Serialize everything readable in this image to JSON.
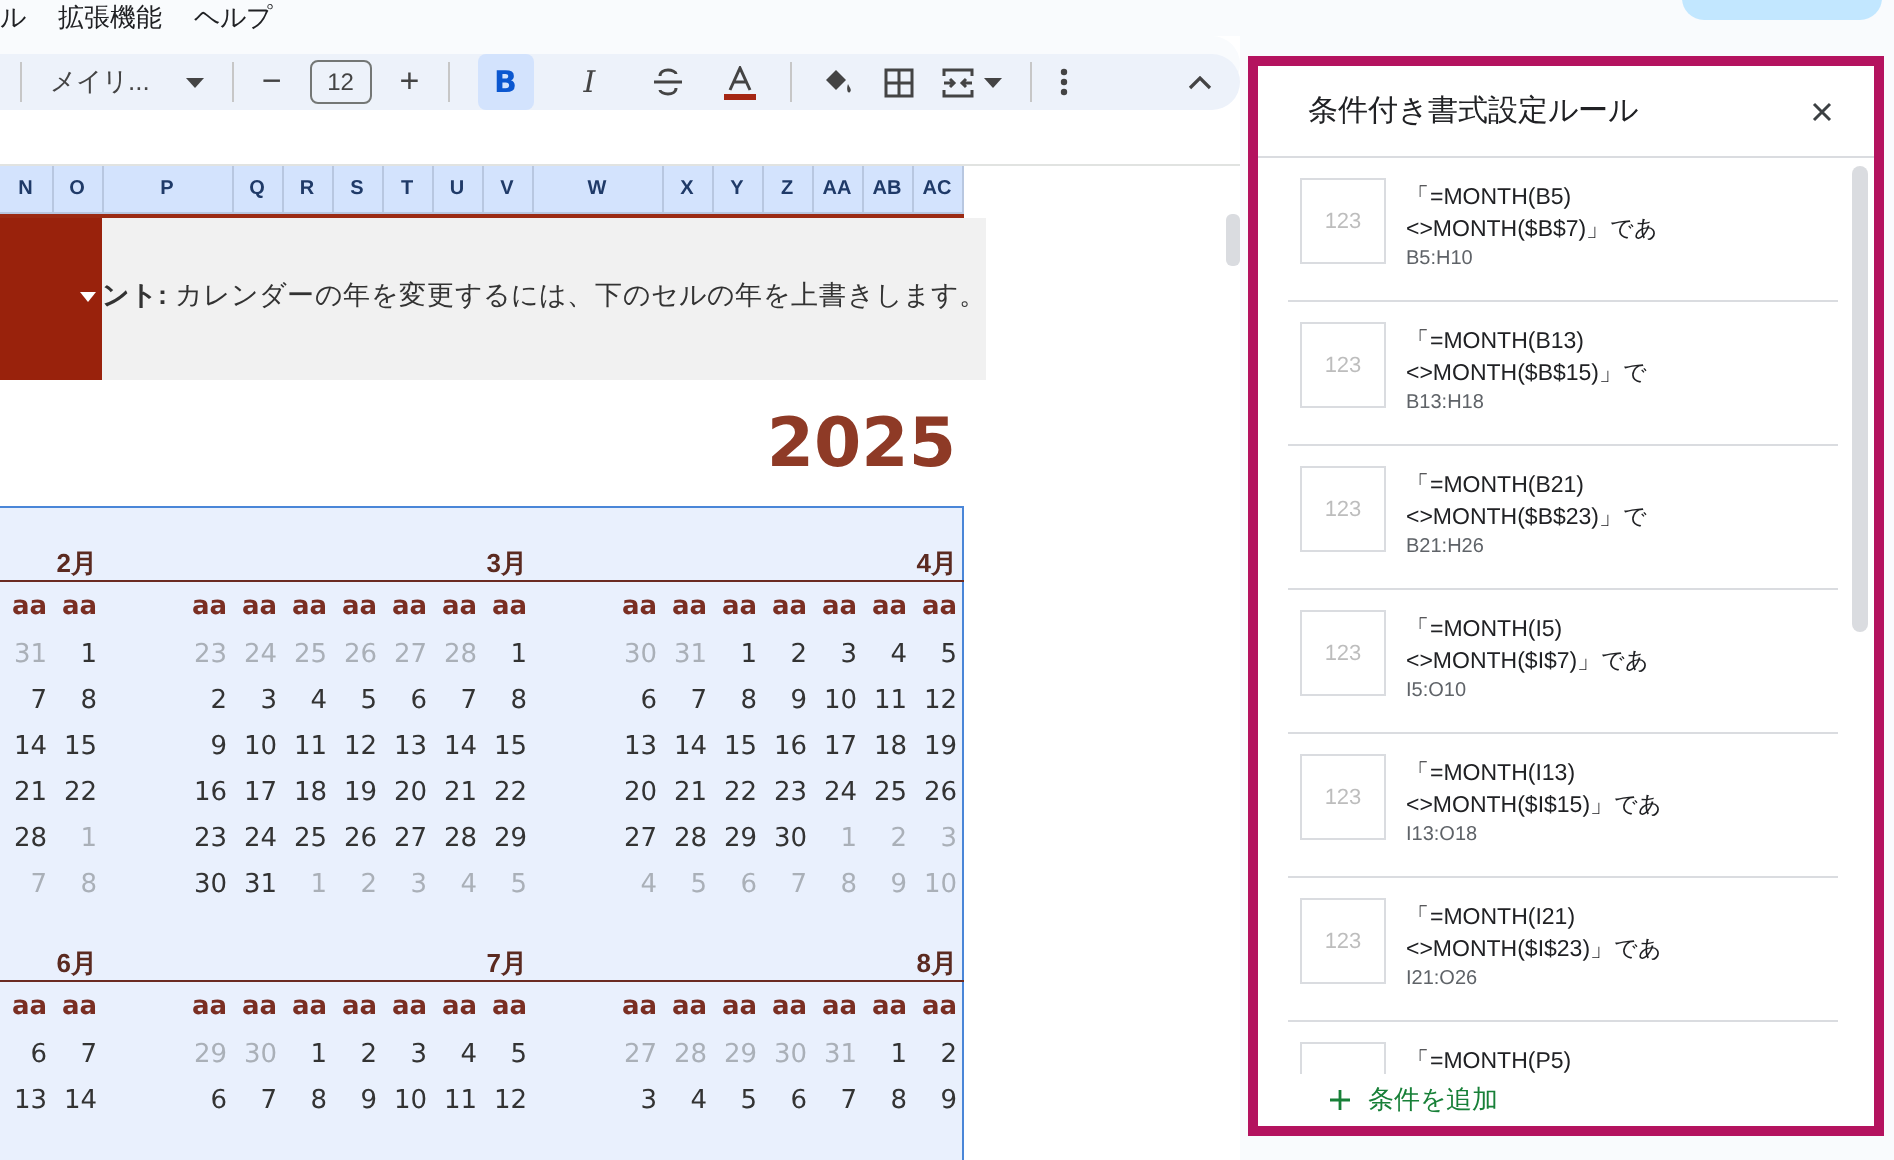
{
  "menu_bar": {
    "items": [
      "ル",
      "拡張機能",
      "ヘルプ"
    ]
  },
  "toolbar": {
    "items": [
      {
        "kind": "separator"
      },
      {
        "kind": "font",
        "label": "メイリ..."
      },
      {
        "kind": "separator"
      },
      {
        "kind": "minus",
        "label": "−"
      },
      {
        "kind": "size",
        "value": "12"
      },
      {
        "kind": "plus",
        "label": "+"
      },
      {
        "kind": "separator"
      },
      {
        "kind": "bold",
        "label": "B",
        "selected": true
      },
      {
        "kind": "italic",
        "label": "I",
        "selected": false
      },
      {
        "kind": "strike",
        "selected": false
      },
      {
        "kind": "text-color",
        "color": "#a52714"
      },
      {
        "kind": "separator"
      },
      {
        "kind": "fill"
      },
      {
        "kind": "borders"
      },
      {
        "kind": "merge"
      },
      {
        "kind": "separator"
      },
      {
        "kind": "more"
      }
    ]
  },
  "columns": [
    "N",
    "O",
    "P",
    "Q",
    "R",
    "S",
    "T",
    "U",
    "V",
    "W",
    "X",
    "Y",
    "Z",
    "AA",
    "AB",
    "AC"
  ],
  "banner": {
    "text": "**ント:** カレンダーの年を変更するには、下のセルの年を上書きします。"
  },
  "year": "2025",
  "calendar": {
    "blocks": [
      {
        "months": [
          {
            "label": "2月",
            "weekdays": [
              "aa",
              "aa"
            ],
            "weeks": [
              [
                {
                  "day": "31",
                  "outside": true
                },
                {
                  "day": "1",
                  "outside": false
                }
              ],
              [
                {
                  "day": "7",
                  "outside": false
                },
                {
                  "day": "8",
                  "outside": false
                }
              ],
              [
                {
                  "day": "14",
                  "outside": false
                },
                {
                  "day": "15",
                  "outside": false
                }
              ],
              [
                {
                  "day": "21",
                  "outside": false
                },
                {
                  "day": "22",
                  "outside": false
                }
              ],
              [
                {
                  "day": "28",
                  "outside": false
                },
                {
                  "day": "1",
                  "outside": true
                }
              ],
              [
                {
                  "day": "7",
                  "outside": true
                },
                {
                  "day": "8",
                  "outside": true
                }
              ]
            ]
          },
          {
            "label": "3月",
            "weekdays": [
              "aa",
              "aa",
              "aa",
              "aa",
              "aa",
              "aa",
              "aa"
            ],
            "weeks": [
              [
                {
                  "day": "23",
                  "outside": true
                },
                {
                  "day": "24",
                  "outside": true
                },
                {
                  "day": "25",
                  "outside": true
                },
                {
                  "day": "26",
                  "outside": true
                },
                {
                  "day": "27",
                  "outside": true
                },
                {
                  "day": "28",
                  "outside": true
                },
                {
                  "day": "1",
                  "outside": false
                }
              ],
              [
                {
                  "day": "2",
                  "outside": false
                },
                {
                  "day": "3",
                  "outside": false
                },
                {
                  "day": "4",
                  "outside": false
                },
                {
                  "day": "5",
                  "outside": false
                },
                {
                  "day": "6",
                  "outside": false
                },
                {
                  "day": "7",
                  "outside": false
                },
                {
                  "day": "8",
                  "outside": false
                }
              ],
              [
                {
                  "day": "9",
                  "outside": false
                },
                {
                  "day": "10",
                  "outside": false
                },
                {
                  "day": "11",
                  "outside": false
                },
                {
                  "day": "12",
                  "outside": false
                },
                {
                  "day": "13",
                  "outside": false
                },
                {
                  "day": "14",
                  "outside": false
                },
                {
                  "day": "15",
                  "outside": false
                }
              ],
              [
                {
                  "day": "16",
                  "outside": false
                },
                {
                  "day": "17",
                  "outside": false
                },
                {
                  "day": "18",
                  "outside": false
                },
                {
                  "day": "19",
                  "outside": false
                },
                {
                  "day": "20",
                  "outside": false
                },
                {
                  "day": "21",
                  "outside": false
                },
                {
                  "day": "22",
                  "outside": false
                }
              ],
              [
                {
                  "day": "23",
                  "outside": false
                },
                {
                  "day": "24",
                  "outside": false
                },
                {
                  "day": "25",
                  "outside": false
                },
                {
                  "day": "26",
                  "outside": false
                },
                {
                  "day": "27",
                  "outside": false
                },
                {
                  "day": "28",
                  "outside": false
                },
                {
                  "day": "29",
                  "outside": false
                }
              ],
              [
                {
                  "day": "30",
                  "outside": false
                },
                {
                  "day": "31",
                  "outside": false
                },
                {
                  "day": "1",
                  "outside": true
                },
                {
                  "day": "2",
                  "outside": true
                },
                {
                  "day": "3",
                  "outside": true
                },
                {
                  "day": "4",
                  "outside": true
                },
                {
                  "day": "5",
                  "outside": true
                }
              ]
            ]
          },
          {
            "label": "4月",
            "weekdays": [
              "aa",
              "aa",
              "aa",
              "aa",
              "aa",
              "aa",
              "aa"
            ],
            "weeks": [
              [
                {
                  "day": "30",
                  "outside": true
                },
                {
                  "day": "31",
                  "outside": true
                },
                {
                  "day": "1",
                  "outside": false
                },
                {
                  "day": "2",
                  "outside": false
                },
                {
                  "day": "3",
                  "outside": false
                },
                {
                  "day": "4",
                  "outside": false
                },
                {
                  "day": "5",
                  "outside": false
                }
              ],
              [
                {
                  "day": "6",
                  "outside": false
                },
                {
                  "day": "7",
                  "outside": false
                },
                {
                  "day": "8",
                  "outside": false
                },
                {
                  "day": "9",
                  "outside": false
                },
                {
                  "day": "10",
                  "outside": false
                },
                {
                  "day": "11",
                  "outside": false
                },
                {
                  "day": "12",
                  "outside": false
                }
              ],
              [
                {
                  "day": "13",
                  "outside": false
                },
                {
                  "day": "14",
                  "outside": false
                },
                {
                  "day": "15",
                  "outside": false
                },
                {
                  "day": "16",
                  "outside": false
                },
                {
                  "day": "17",
                  "outside": false
                },
                {
                  "day": "18",
                  "outside": false
                },
                {
                  "day": "19",
                  "outside": false
                }
              ],
              [
                {
                  "day": "20",
                  "outside": false
                },
                {
                  "day": "21",
                  "outside": false
                },
                {
                  "day": "22",
                  "outside": false
                },
                {
                  "day": "23",
                  "outside": false
                },
                {
                  "day": "24",
                  "outside": false
                },
                {
                  "day": "25",
                  "outside": false
                },
                {
                  "day": "26",
                  "outside": false
                }
              ],
              [
                {
                  "day": "27",
                  "outside": false
                },
                {
                  "day": "28",
                  "outside": false
                },
                {
                  "day": "29",
                  "outside": false
                },
                {
                  "day": "30",
                  "outside": false
                },
                {
                  "day": "1",
                  "outside": true
                },
                {
                  "day": "2",
                  "outside": true
                },
                {
                  "day": "3",
                  "outside": true
                }
              ],
              [
                {
                  "day": "4",
                  "outside": true
                },
                {
                  "day": "5",
                  "outside": true
                },
                {
                  "day": "6",
                  "outside": true
                },
                {
                  "day": "7",
                  "outside": true
                },
                {
                  "day": "8",
                  "outside": true
                },
                {
                  "day": "9",
                  "outside": true
                },
                {
                  "day": "10",
                  "outside": true
                }
              ]
            ]
          }
        ]
      },
      {
        "months": [
          {
            "label": "6月",
            "weekdays": [
              "aa",
              "aa"
            ],
            "weeks": [
              [
                {
                  "day": "6",
                  "outside": false
                },
                {
                  "day": "7",
                  "outside": false
                }
              ],
              [
                {
                  "day": "13",
                  "outside": false
                },
                {
                  "day": "14",
                  "outside": false
                }
              ]
            ]
          },
          {
            "label": "7月",
            "weekdays": [
              "aa",
              "aa",
              "aa",
              "aa",
              "aa",
              "aa",
              "aa"
            ],
            "weeks": [
              [
                {
                  "day": "29",
                  "outside": true
                },
                {
                  "day": "30",
                  "outside": true
                },
                {
                  "day": "1",
                  "outside": false
                },
                {
                  "day": "2",
                  "outside": false
                },
                {
                  "day": "3",
                  "outside": false
                },
                {
                  "day": "4",
                  "outside": false
                },
                {
                  "day": "5",
                  "outside": false
                }
              ],
              [
                {
                  "day": "6",
                  "outside": false
                },
                {
                  "day": "7",
                  "outside": false
                },
                {
                  "day": "8",
                  "outside": false
                },
                {
                  "day": "9",
                  "outside": false
                },
                {
                  "day": "10",
                  "outside": false
                },
                {
                  "day": "11",
                  "outside": false
                },
                {
                  "day": "12",
                  "outside": false
                }
              ]
            ]
          },
          {
            "label": "8月",
            "weekdays": [
              "aa",
              "aa",
              "aa",
              "aa",
              "aa",
              "aa",
              "aa"
            ],
            "weeks": [
              [
                {
                  "day": "27",
                  "outside": true
                },
                {
                  "day": "28",
                  "outside": true
                },
                {
                  "day": "29",
                  "outside": true
                },
                {
                  "day": "30",
                  "outside": true
                },
                {
                  "day": "31",
                  "outside": true
                },
                {
                  "day": "1",
                  "outside": false
                },
                {
                  "day": "2",
                  "outside": false
                }
              ],
              [
                {
                  "day": "3",
                  "outside": false
                },
                {
                  "day": "4",
                  "outside": false
                },
                {
                  "day": "5",
                  "outside": false
                },
                {
                  "day": "6",
                  "outside": false
                },
                {
                  "day": "7",
                  "outside": false
                },
                {
                  "day": "8",
                  "outside": false
                },
                {
                  "day": "9",
                  "outside": false
                }
              ]
            ]
          }
        ]
      }
    ]
  },
  "panel": {
    "title": "条件付き書式設定ルール",
    "rules": [
      {
        "preview": "123",
        "lines": [
          "「=MONTH(B5)",
          "<>MONTH($B$7)」であ"
        ],
        "range": "B5:H10"
      },
      {
        "preview": "123",
        "lines": [
          "「=MONTH(B13)",
          "<>MONTH($B$15)」で"
        ],
        "range": "B13:H18"
      },
      {
        "preview": "123",
        "lines": [
          "「=MONTH(B21)",
          "<>MONTH($B$23)」で"
        ],
        "range": "B21:H26"
      },
      {
        "preview": "123",
        "lines": [
          "「=MONTH(I5)",
          "<>MONTH($I$7)」であ"
        ],
        "range": "I5:O10"
      },
      {
        "preview": "123",
        "lines": [
          "「=MONTH(I13)",
          "<>MONTH($I$15)」であ"
        ],
        "range": "I13:O18"
      },
      {
        "preview": "123",
        "lines": [
          "「=MONTH(I21)",
          "<>MONTH($I$23)」であ"
        ],
        "range": "I21:O26"
      },
      {
        "lines": [
          "「=MONTH(P5)"
        ]
      }
    ],
    "add_label": "条件を追加"
  }
}
